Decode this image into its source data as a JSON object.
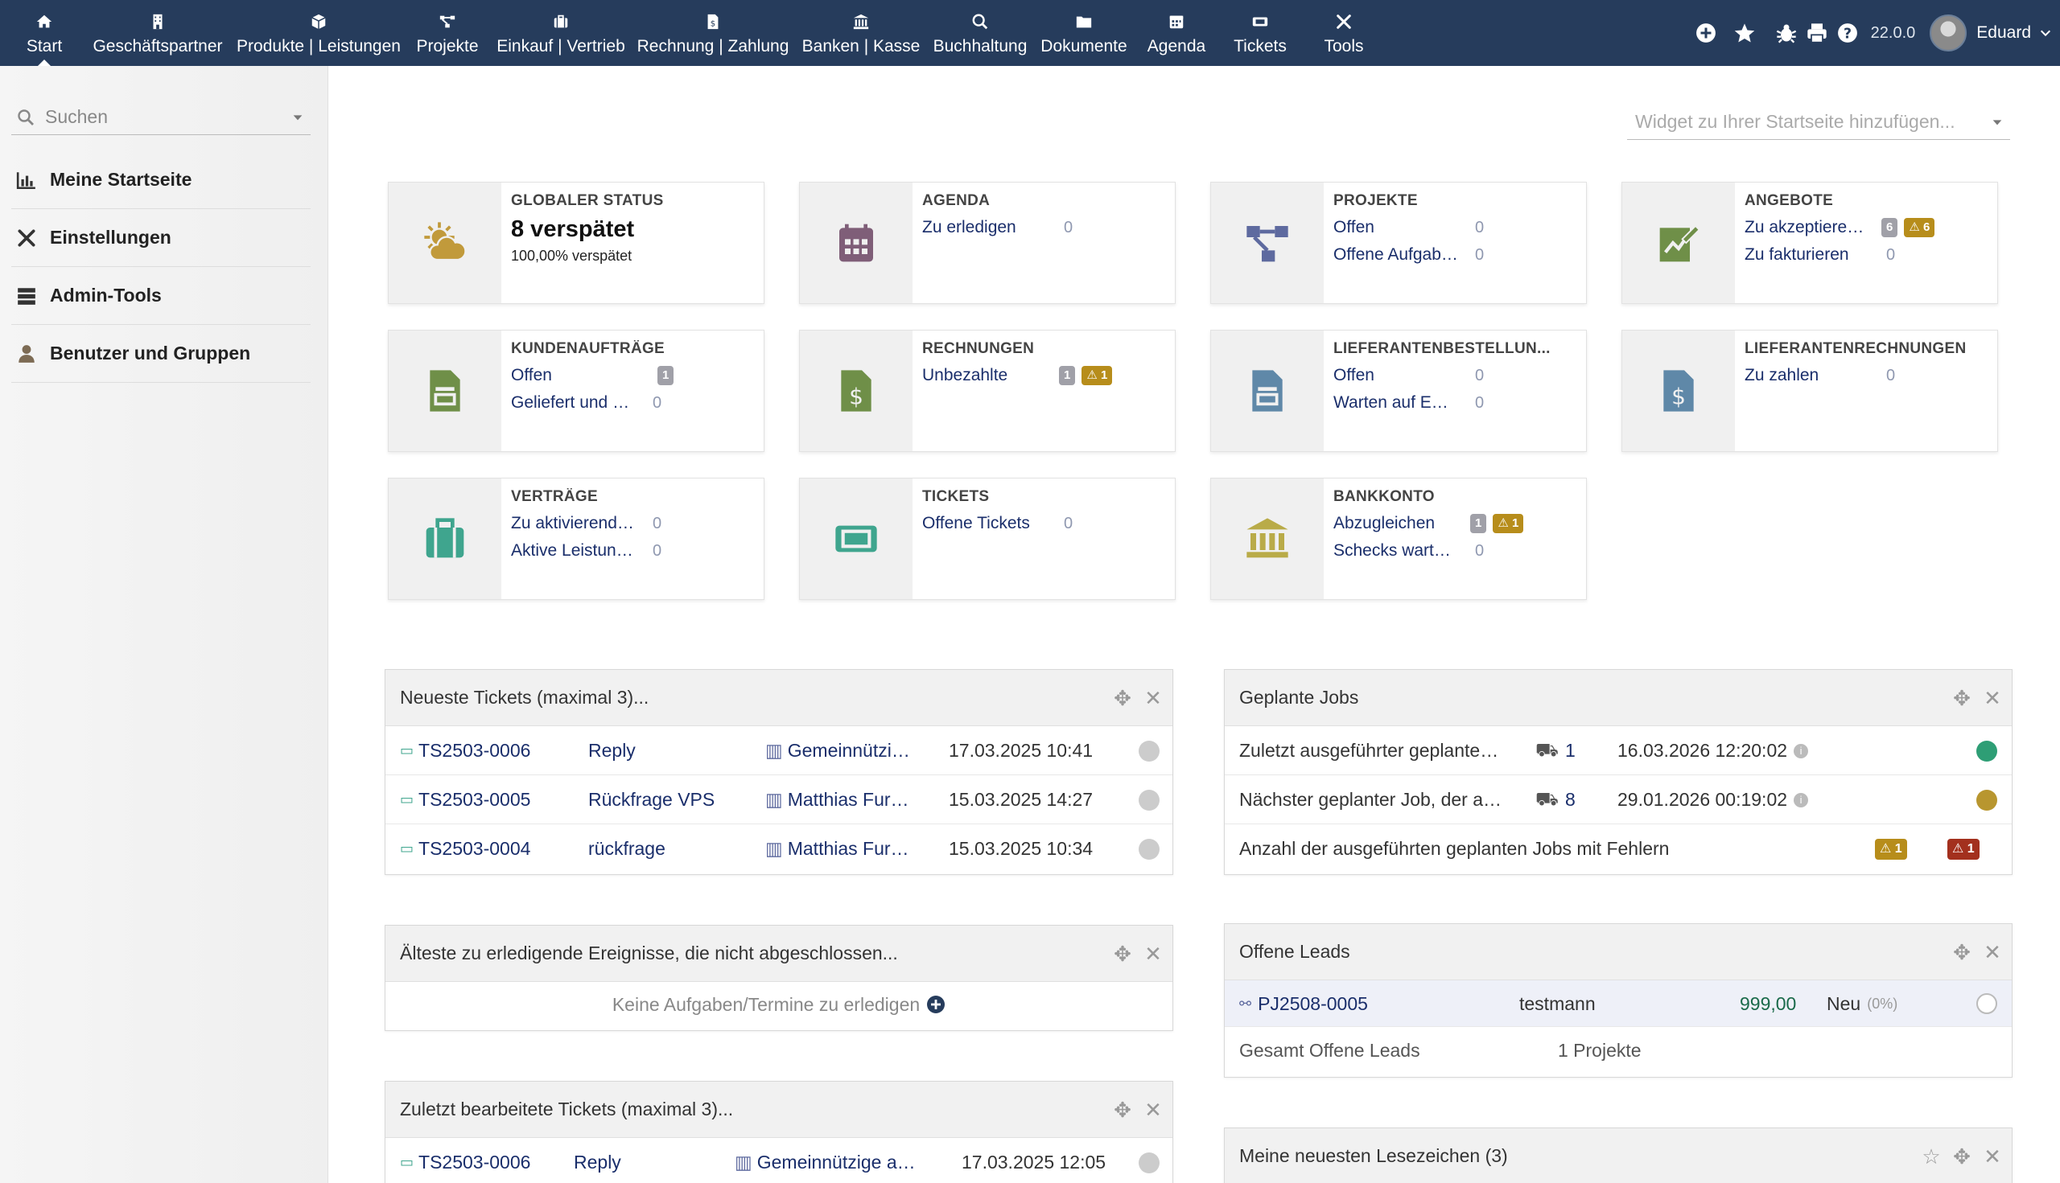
{
  "nav": {
    "items": [
      {
        "label": "Start",
        "icon": "home-icon"
      },
      {
        "label": "Geschäftspartner",
        "icon": "building-icon"
      },
      {
        "label": "Produkte | Leistungen",
        "icon": "cube-icon"
      },
      {
        "label": "Projekte",
        "icon": "project-icon"
      },
      {
        "label": "Einkauf | Vertrieb",
        "icon": "briefcase-icon"
      },
      {
        "label": "Rechnung | Zahlung",
        "icon": "invoice-icon"
      },
      {
        "label": "Banken | Kasse",
        "icon": "bank-icon"
      },
      {
        "label": "Buchhaltung",
        "icon": "search-dollar-icon"
      },
      {
        "label": "Dokumente",
        "icon": "folder-icon"
      },
      {
        "label": "Agenda",
        "icon": "calendar-icon"
      },
      {
        "label": "Tickets",
        "icon": "ticket-icon"
      },
      {
        "label": "Tools",
        "icon": "tools-icon"
      }
    ],
    "version": "22.0.0",
    "user": "Eduard"
  },
  "sidebar": {
    "search_placeholder": "Suchen",
    "items": [
      {
        "label": "Meine Startseite",
        "icon": "chart-icon"
      },
      {
        "label": "Einstellungen",
        "icon": "tools-icon"
      },
      {
        "label": "Admin-Tools",
        "icon": "server-icon"
      },
      {
        "label": "Benutzer und Gruppen",
        "icon": "user-icon"
      }
    ]
  },
  "widget_select": "Widget zu Ihrer Startseite hinzufügen...",
  "boxes": {
    "global": {
      "title": "GLOBALER STATUS",
      "big": "8 verspätet",
      "small": "100,00% verspätet"
    },
    "agenda": {
      "title": "AGENDA",
      "lines": [
        {
          "label": "Zu erledigen",
          "num": "0"
        }
      ]
    },
    "projekte": {
      "title": "PROJEKTE",
      "lines": [
        {
          "label": "Offen",
          "num": "0"
        },
        {
          "label": "Offene Aufgab…",
          "num": "0"
        }
      ]
    },
    "angebote": {
      "title": "ANGEBOTE",
      "lines": [
        {
          "label": "Zu akzeptiere…",
          "badge": "6",
          "warn": "6"
        },
        {
          "label": "Zu fakturieren",
          "num": "0"
        }
      ]
    },
    "kundenauftraege": {
      "title": "KUNDENAUFTRÄGE",
      "lines": [
        {
          "label": "Offen",
          "badge": "1"
        },
        {
          "label": "Geliefert und …",
          "num": "0"
        }
      ]
    },
    "rechnungen": {
      "title": "RECHNUNGEN",
      "lines": [
        {
          "label": "Unbezahlte",
          "badge": "1",
          "warn": "1"
        }
      ]
    },
    "lieferantenbestellungen": {
      "title": "LIEFERANTENBESTELLUN...",
      "lines": [
        {
          "label": "Offen",
          "num": "0"
        },
        {
          "label": "Warten auf E…",
          "num": "0"
        }
      ]
    },
    "lieferantenrechnungen": {
      "title": "LIEFERANTENRECHNUNGEN",
      "lines": [
        {
          "label": "Zu zahlen",
          "num": "0"
        }
      ]
    },
    "vertraege": {
      "title": "VERTRÄGE",
      "lines": [
        {
          "label": "Zu aktivierend…",
          "num": "0"
        },
        {
          "label": "Aktive Leistun…",
          "num": "0"
        }
      ]
    },
    "tickets": {
      "title": "TICKETS",
      "lines": [
        {
          "label": "Offene Tickets",
          "num": "0"
        }
      ]
    },
    "bankkonto": {
      "title": "BANKKONTO",
      "lines": [
        {
          "label": "Abzugleichen",
          "badge": "1",
          "warn": "1"
        },
        {
          "label": "Schecks wart…",
          "num": "0"
        }
      ]
    }
  },
  "panels": {
    "newest_tickets": {
      "title": "Neueste Tickets (maximal 3)...",
      "rows": [
        {
          "ref": "TS2503-0006",
          "subject": "Reply",
          "company": "Gemeinnützi…",
          "date": "17.03.2025 10:41"
        },
        {
          "ref": "TS2503-0005",
          "subject": "Rückfrage VPS",
          "company": "Matthias Fur…",
          "date": "15.03.2025 14:27"
        },
        {
          "ref": "TS2503-0004",
          "subject": "rückfrage",
          "company": "Matthias Fur…",
          "date": "15.03.2025 10:34"
        }
      ]
    },
    "oldest_events": {
      "title": "Älteste zu erledigende Ereignisse, die nicht abgeschlossen...",
      "empty": "Keine Aufgaben/Termine zu erledigen"
    },
    "last_edited_tickets": {
      "title": "Zuletzt bearbeitete Tickets (maximal 3)...",
      "rows": [
        {
          "ref": "TS2503-0006",
          "subject": "Reply",
          "company": "Gemeinnützige a…",
          "date": "17.03.2025 12:05"
        }
      ]
    },
    "planned_jobs": {
      "title": "Geplante Jobs",
      "rows": [
        {
          "label": "Zuletzt ausgeführter geplante…",
          "count": "1",
          "date": "16.03.2026 12:20:02",
          "status_color": "#2e9e75"
        },
        {
          "label": "Nächster geplanter Job, der a…",
          "count": "8",
          "date": "29.01.2026 00:19:02",
          "status_color": "#b8962f"
        }
      ],
      "error_row": {
        "label": "Anzahl der ausgeführten geplanten Jobs mit Fehlern",
        "warn": "1",
        "err": "1"
      }
    },
    "open_leads": {
      "title": "Offene Leads",
      "row": {
        "ref": "PJ2508-0005",
        "name": "testmann",
        "amount": "999,00",
        "status": "Neu",
        "percent": "(0%)"
      },
      "total": {
        "label": "Gesamt Offene Leads",
        "value": "1 Projekte"
      }
    },
    "bookmarks": {
      "title": "Meine neuesten Lesezeichen (3)"
    }
  }
}
